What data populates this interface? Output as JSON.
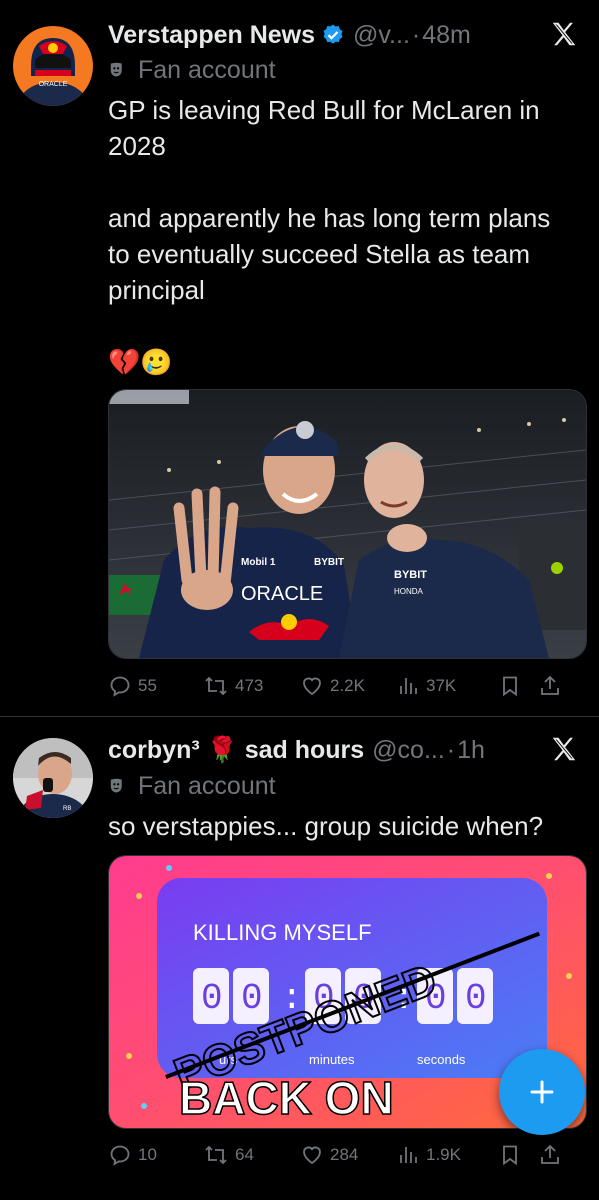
{
  "tweets": [
    {
      "author": "Verstappen News",
      "handle": "@v...",
      "separator": "·",
      "time": "48m",
      "label": "Fan account",
      "text": "GP is leaving Red Bull for McLaren in 2028\n\nand apparently he has long term plans to eventually succeed Stella as team principal\n\n💔🥲",
      "media": {
        "left_cap": "ORACLE",
        "right_sponsor": "BYBIT",
        "right_sub": "HONDA",
        "left_small": "Mobil 1",
        "left_bybit": "BYBIT"
      },
      "stats": {
        "replies": "55",
        "reposts": "473",
        "likes": "2.2K",
        "views": "37K"
      }
    },
    {
      "author": "corbyn³ 🌹 sad hours",
      "handle": "@co...",
      "separator": "·",
      "time": "1h",
      "label": "Fan account",
      "text": "so verstappies... group suicide when?",
      "media": {
        "top_text": "KILLING MYSELF",
        "digits": [
          "0",
          "0",
          "0",
          "0",
          "0",
          "0"
        ],
        "colon": ":",
        "unit_hours": "urs",
        "unit_minutes": "minutes",
        "unit_seconds": "seconds",
        "overlay": "POSTPONED",
        "bottom": "BACK ON"
      },
      "stats": {
        "replies": "10",
        "reposts": "64",
        "likes": "284",
        "views": "1.9K"
      }
    }
  ],
  "colors": {
    "accent": "#1d9bf0",
    "muted": "#71767b",
    "text": "#e7e9ea"
  }
}
